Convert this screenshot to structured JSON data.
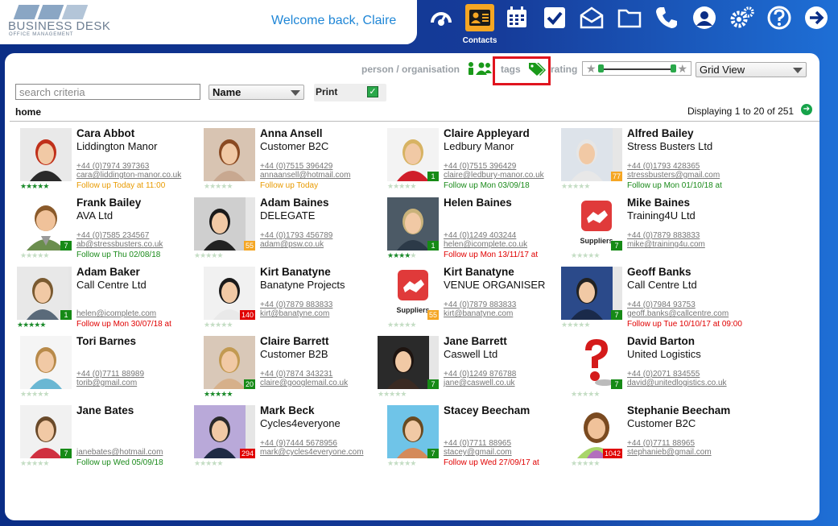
{
  "brand": {
    "name": "BUSINESS DESK",
    "tagline": "OFFICE MANAGEMENT"
  },
  "header": {
    "welcome": "Welcome back, Claire",
    "active_label": "Contacts"
  },
  "nav": [
    "dashboard-icon",
    "contacts-icon",
    "calendar-icon",
    "tasks-icon",
    "mail-icon",
    "folder-icon",
    "phone-icon",
    "account-icon",
    "settings-icon",
    "help-icon",
    "logout-icon"
  ],
  "filters": {
    "person_org": "person / organisation",
    "tags": "tags",
    "rating": "rating",
    "view": "Grid View"
  },
  "search": {
    "placeholder": "search criteria",
    "sort": "Name",
    "print": "Print"
  },
  "breadcrumb": "home",
  "pagination": "Displaying 1 to 20 of 251",
  "colors": {
    "accent": "#f5a623",
    "follow_orange": "#e89a00",
    "follow_green": "#1a8a1a",
    "follow_red": "#e00000",
    "header": "#0a2d86"
  },
  "contacts": [
    {
      "name": "Cara Abbot",
      "org": "Liddington Manor",
      "phone": "+44 (0)7974 397363",
      "email": "cara@liddington-manor.co.uk",
      "follow": "Follow up Today at 11:00",
      "follow_color": "orange",
      "badge": "",
      "badge_color": "",
      "stars": 5,
      "photo": "photo-female-red"
    },
    {
      "name": "Anna Ansell",
      "org": "Customer B2C",
      "phone": "+44 (0)7515 396429",
      "email": "annaansell@hotmail.com",
      "follow": "Follow up Today",
      "follow_color": "orange",
      "badge": "",
      "badge_color": "",
      "stars": 0,
      "photo": "photo-female-auburn"
    },
    {
      "name": "Claire Appleyard",
      "org": "Ledbury Manor",
      "phone": "+44 (0)7515 396429",
      "email": "claire@ledbury-manor.co.uk",
      "follow": "Follow up Mon 03/09/18",
      "follow_color": "green",
      "badge": "1",
      "badge_color": "green",
      "stars": 0,
      "photo": "photo-female-blonde"
    },
    {
      "name": "Alfred Bailey",
      "org": "Stress Busters Ltd",
      "phone": "+44 (0)1793 428365",
      "email": "stressbusters@gmail.com",
      "follow": "Follow up Mon 01/10/18 at",
      "follow_color": "green",
      "badge": "77",
      "badge_color": "orange",
      "stars": 0,
      "photo": "photo-elderly-male"
    },
    {
      "name": "Frank Bailey",
      "org": "AVA Ltd",
      "phone": "+44 (0)7585 234567",
      "email": "ab@stressbusters.co.uk",
      "follow": "Follow up Thu 02/08/18",
      "follow_color": "green",
      "badge": "7",
      "badge_color": "green",
      "stars": 0,
      "photo": "photo-avatar-male"
    },
    {
      "name": "Adam Baines",
      "org": "DELEGATE",
      "phone": "+44 (0)1793 456789",
      "email": "adam@psw.co.uk",
      "follow": "",
      "follow_color": "green",
      "badge": "55",
      "badge_color": "orange",
      "stars": 0,
      "photo": "photo-male-phone"
    },
    {
      "name": "Helen Baines",
      "org": "",
      "phone": "+44 (0)1249 403244",
      "email": "helen@icomplete.co.uk",
      "follow": "Follow up Mon 13/11/17 at",
      "follow_color": "red",
      "badge": "1",
      "badge_color": "green",
      "stars": 4,
      "photo": "photo-female-car"
    },
    {
      "name": "Mike Baines",
      "org": "Training4U Ltd",
      "phone": "+44 (0)7879 883833",
      "email": "mike@training4u.com",
      "follow": "",
      "follow_color": "green",
      "badge": "7",
      "badge_color": "green",
      "stars": 0,
      "photo": "photo-suppliers"
    },
    {
      "name": "Adam Baker",
      "org": "Call Centre Ltd",
      "phone": "",
      "email": "helen@icomplete.com",
      "follow": "Follow up Mon 30/07/18 at",
      "follow_color": "red",
      "badge": "1",
      "badge_color": "green",
      "stars": 5,
      "photo": "photo-male-smile"
    },
    {
      "name": "Kirt Banatyne",
      "org": "Banatyne Projects",
      "phone": "+44 (0)7879 883833",
      "email": "kirt@banatyne.com",
      "follow": "",
      "follow_color": "green",
      "badge": "140",
      "badge_color": "red",
      "stars": 0,
      "photo": "photo-male-beard"
    },
    {
      "name": "Kirt Banatyne",
      "org": "VENUE ORGANISER",
      "phone": "+44 (0)7879 883833",
      "email": "kirt@banatyne.com",
      "follow": "",
      "follow_color": "green",
      "badge": "55",
      "badge_color": "orange",
      "stars": 0,
      "photo": "photo-suppliers"
    },
    {
      "name": "Geoff Banks",
      "org": "Call Centre Ltd",
      "phone": "+44 (0)7984 93753",
      "email": "geoff.banks@callcentre.com",
      "follow": "Follow up Tue 10/10/17 at 09:00",
      "follow_color": "red",
      "badge": "7",
      "badge_color": "green",
      "stars": 0,
      "photo": "photo-male-blue"
    },
    {
      "name": "Tori Barnes",
      "org": "",
      "phone": "+44 (0)7711 88989",
      "email": "torib@gmail.com",
      "follow": "",
      "follow_color": "green",
      "badge": "",
      "badge_color": "",
      "stars": 0,
      "photo": "photo-female-glasses"
    },
    {
      "name": "Claire Barrett",
      "org": "Customer B2B",
      "phone": "+44 (0)7874 343231",
      "email": "claire@googlemail.co.uk",
      "follow": "",
      "follow_color": "green",
      "badge": "20",
      "badge_color": "green",
      "stars": 5,
      "photo": "photo-female-makeup"
    },
    {
      "name": "Jane Barrett",
      "org": "Caswell Ltd",
      "phone": "+44 (0)1249 876788",
      "email": "jane@caswell.co.uk",
      "follow": "",
      "follow_color": "green",
      "badge": "7",
      "badge_color": "green",
      "stars": 0,
      "photo": "photo-female-dark"
    },
    {
      "name": "David Barton",
      "org": "United Logistics",
      "phone": "+44 (0)2071 834555",
      "email": "david@unitedlogistics.co.uk",
      "follow": "",
      "follow_color": "green",
      "badge": "7",
      "badge_color": "green",
      "stars": 0,
      "photo": "photo-question"
    },
    {
      "name": "Jane Bates",
      "org": "",
      "phone": "",
      "email": "janebates@hotmail.com",
      "follow": "Follow up Wed 05/09/18",
      "follow_color": "green",
      "badge": "7",
      "badge_color": "green",
      "stars": 0,
      "photo": "photo-female-standing"
    },
    {
      "name": "Mark Beck",
      "org": "Cycles4everyone",
      "phone": "+44 (9)7444 5678956",
      "email": "mark@cycles4everyone.com",
      "follow": "",
      "follow_color": "green",
      "badge": "294",
      "badge_color": "red",
      "stars": 0,
      "photo": "photo-male-suit"
    },
    {
      "name": "Stacey Beecham",
      "org": "",
      "phone": "+44 (0)7711 88965",
      "email": "stacey@gmail.com",
      "follow": "Follow up Wed 27/09/17 at",
      "follow_color": "red",
      "badge": "7",
      "badge_color": "green",
      "stars": 0,
      "photo": "photo-female-beach"
    },
    {
      "name": "Stephanie Beecham",
      "org": "Customer B2C",
      "phone": "+44 (0)7711 88965",
      "email": "stephanieb@gmail.com",
      "follow": "",
      "follow_color": "green",
      "badge": "1042",
      "badge_color": "red",
      "stars": 0,
      "photo": "photo-avatar-female"
    }
  ],
  "photo_labels": {
    "suppliers": "Suppliers"
  }
}
